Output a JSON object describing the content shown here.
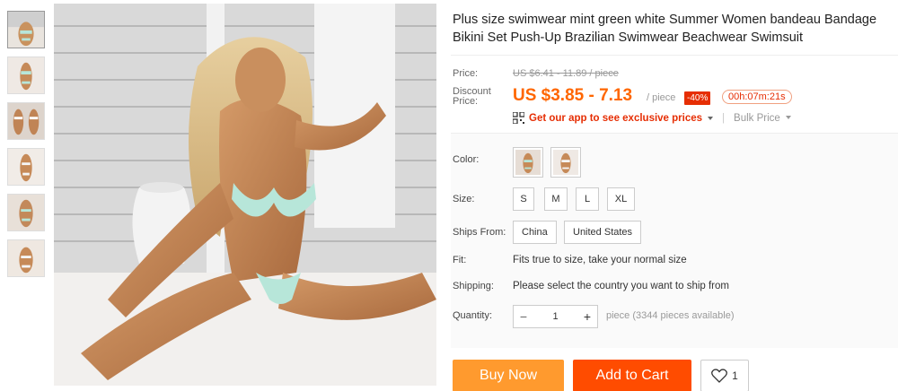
{
  "product": {
    "title": "Plus size swimwear mint green white Summer Women bandeau Bandage Bikini Set Push-Up Brazilian Swimwear Beachwear Swimsuit"
  },
  "gallery": {
    "thumbnail_count": 6,
    "active_index": 0
  },
  "price": {
    "price_label": "Price:",
    "original": "US $6.41 - 11.89 / piece",
    "discount_label": "Discount Price:",
    "current": "US $3.85 - 7.13",
    "per_unit": "/ piece",
    "discount_badge": "-40%",
    "countdown": "00h:07m:21s",
    "app_promo": "Get our app to see exclusive prices",
    "bulk_price": "Bulk Price"
  },
  "options": {
    "color_label": "Color:",
    "size_label": "Size:",
    "sizes": [
      "S",
      "M",
      "L",
      "XL"
    ],
    "ships_from_label": "Ships From:",
    "ships_from": [
      "China",
      "United States"
    ],
    "fit_label": "Fit:",
    "fit_text": "Fits true to size, take your normal size",
    "shipping_label": "Shipping:",
    "shipping_text": "Please select the country you want to ship from",
    "quantity_label": "Quantity:",
    "quantity_value": "1",
    "quantity_minus": "−",
    "quantity_plus": "+",
    "availability": "piece (3344 pieces available)"
  },
  "actions": {
    "buy_now": "Buy Now",
    "add_to_cart": "Add to Cart",
    "wishlist_count": "1"
  },
  "colors": {
    "price_orange": "#ff6600",
    "buy_now_bg": "#ff9a2e",
    "add_to_cart_bg": "#ff4c00",
    "badge_red": "#e62e04",
    "swimsuit_mint": "#b7e6d9"
  }
}
